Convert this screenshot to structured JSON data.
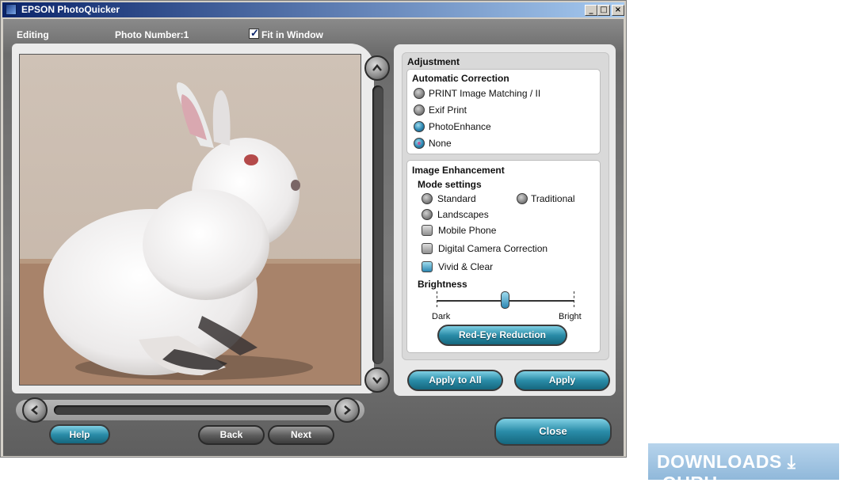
{
  "window": {
    "title": "EPSON PhotoQuicker",
    "controls": {
      "minimize": "_",
      "maximize": "□",
      "close": "×"
    }
  },
  "infobar": {
    "mode": "Editing",
    "photo_number": "Photo Number:1",
    "fit_label": "Fit in Window",
    "fit_checked": true
  },
  "photo": {
    "icon": "rabbit-photo"
  },
  "nav": {
    "help": "Help",
    "back": "Back",
    "next": "Next",
    "close": "Close"
  },
  "adjustment": {
    "title": "Adjustment",
    "auto_correction": {
      "title": "Automatic Correction",
      "options": [
        "PRINT Image Matching / II",
        "Exif Print",
        "PhotoEnhance",
        "None"
      ],
      "selected": "None"
    },
    "enhancement": {
      "title": "Image Enhancement",
      "mode_title": "Mode settings",
      "modes": [
        "Standard",
        "Traditional",
        "Landscapes"
      ],
      "checkboxes": [
        "Mobile Phone",
        "Digital Camera Correction",
        "Vivid & Clear"
      ],
      "vivid_checked": true,
      "brightness": {
        "title": "Brightness",
        "min_label": "Dark",
        "max_label": "Bright",
        "level": 0.5
      },
      "red_eye": "Red-Eye Reduction"
    },
    "apply_all": "Apply to All",
    "apply": "Apply"
  },
  "watermark": {
    "text": "DOWNLOADS ⤓ .GURU"
  },
  "colors": {
    "accent": "#2a8ca8",
    "titlebar": "#0a246a"
  }
}
